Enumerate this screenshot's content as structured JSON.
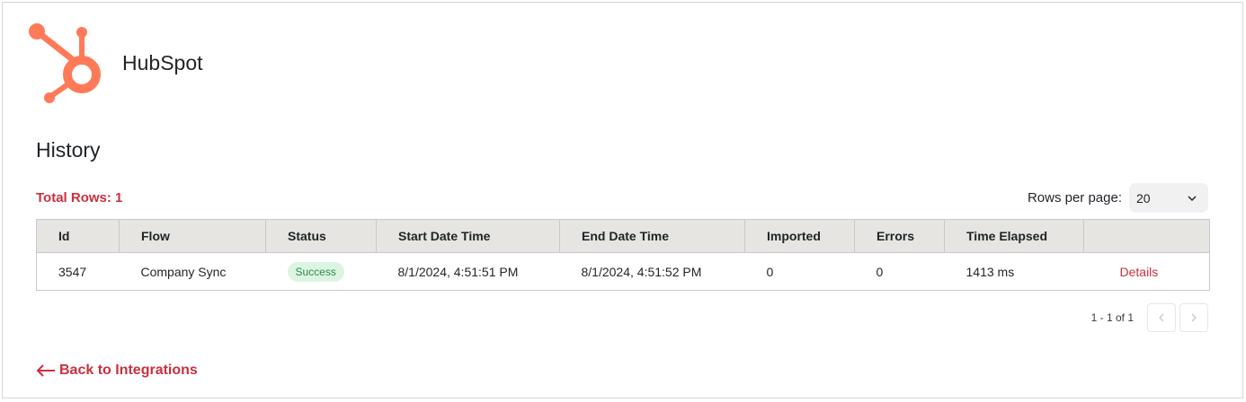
{
  "app": {
    "name": "HubSpot",
    "brand_color": "#ff7a59"
  },
  "history": {
    "title": "History",
    "total_rows_label": "Total Rows: 1",
    "rows_per_page_label": "Rows per page:",
    "rows_per_page_value": "20"
  },
  "table": {
    "columns": [
      "Id",
      "Flow",
      "Status",
      "Start Date Time",
      "End Date Time",
      "Imported",
      "Errors",
      "Time Elapsed",
      ""
    ],
    "rows": [
      {
        "id": "3547",
        "flow": "Company Sync",
        "status": "Success",
        "start": "8/1/2024, 4:51:51 PM",
        "end": "8/1/2024, 4:51:52 PM",
        "imported": "0",
        "errors": "0",
        "elapsed": "1413 ms",
        "action": "Details"
      }
    ]
  },
  "pagination": {
    "info": "1 - 1 of 1",
    "prev_icon": "chevron-left-icon",
    "next_icon": "chevron-right-icon"
  },
  "footer": {
    "back_label": "Back to Integrations",
    "accent": "#c9303f"
  }
}
